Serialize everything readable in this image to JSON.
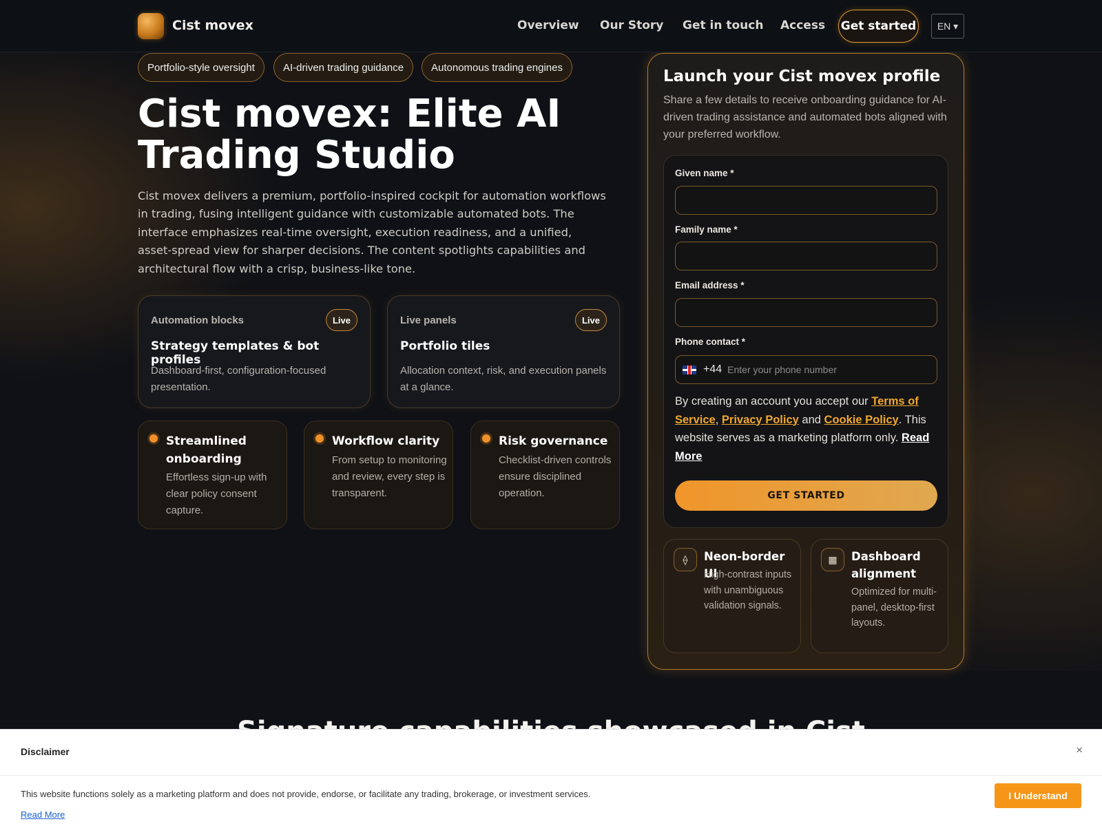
{
  "header": {
    "brand": "Cist movex",
    "nav": [
      "Overview",
      "Our Story",
      "Get in touch",
      "Access"
    ],
    "cta": "Get started",
    "language": "EN ▾"
  },
  "hero": {
    "pills": [
      "Portfolio-style oversight",
      "AI-driven trading guidance",
      "Autonomous trading engines"
    ],
    "title": "Cist movex: Elite AI Trading Studio",
    "description": "Cist movex delivers a premium, portfolio-inspired cockpit for automation workflows in trading, fusing intelligent guidance with customizable automated bots. The interface emphasizes real-time oversight, execution readiness, and a unified, asset-spread view for sharper decisions. The content spotlights capabilities and architectural flow with a crisp, business-like tone.",
    "feature_cards": [
      {
        "tag": "Automation blocks",
        "badge": "Live",
        "title": "Strategy templates & bot profiles",
        "desc": "Dashboard-first, configuration-focused presentation."
      },
      {
        "tag": "Live panels",
        "badge": "Live",
        "title": "Portfolio tiles",
        "desc": "Allocation context, risk, and execution panels at a glance."
      }
    ],
    "small_cards": [
      {
        "title": "Streamlined onboarding",
        "desc": "Effortless sign-up with clear policy consent capture."
      },
      {
        "title": "Workflow clarity",
        "desc": "From setup to monitoring and review, every step is transparent."
      },
      {
        "title": "Risk governance",
        "desc": "Checklist-driven controls ensure disciplined operation."
      }
    ]
  },
  "form": {
    "title": "Launch your Cist movex profile",
    "subtitle": "Share a few details to receive onboarding guidance for AI-driven trading assistance and automated bots aligned with your preferred workflow.",
    "given_name_label": "Given name *",
    "family_name_label": "Family name *",
    "email_label": "Email address *",
    "phone_label": "Phone contact *",
    "given_name_value": "",
    "family_name_value": "",
    "email_value": "",
    "dial_code": "+44",
    "phone_placeholder": "Enter your phone number",
    "consent_prefix": "By creating an account you accept our",
    "terms": "Terms of Service",
    "privacy": "Privacy Policy",
    "and": "and",
    "cookie": "Cookie Policy",
    "consent_suffix": ". This website serves as a marketing platform only.",
    "read_more": "Read More",
    "submit": "GET STARTED"
  },
  "mini_cards": [
    {
      "icon": "diamond-icon",
      "glyph": "⟠",
      "title": "Neon-border UI",
      "desc": "High-contrast inputs with unambiguous validation signals."
    },
    {
      "icon": "grid-icon",
      "glyph": "▦",
      "title": "Dashboard alignment",
      "desc": "Optimized for multi-panel, desktop-first layouts."
    }
  ],
  "next_section_heading": "Signature capabilities showcased in Cist",
  "disclaimer": {
    "title": "Disclaimer",
    "close": "×",
    "text": "This website functions solely as a marketing platform and does not provide, endorse, or facilitate any trading, brokerage, or investment services.",
    "link": "Read More",
    "button": "I Understand"
  },
  "colors": {
    "accent": "#f0952a",
    "background": "#0f1116",
    "link_gold": "#f0a830"
  }
}
